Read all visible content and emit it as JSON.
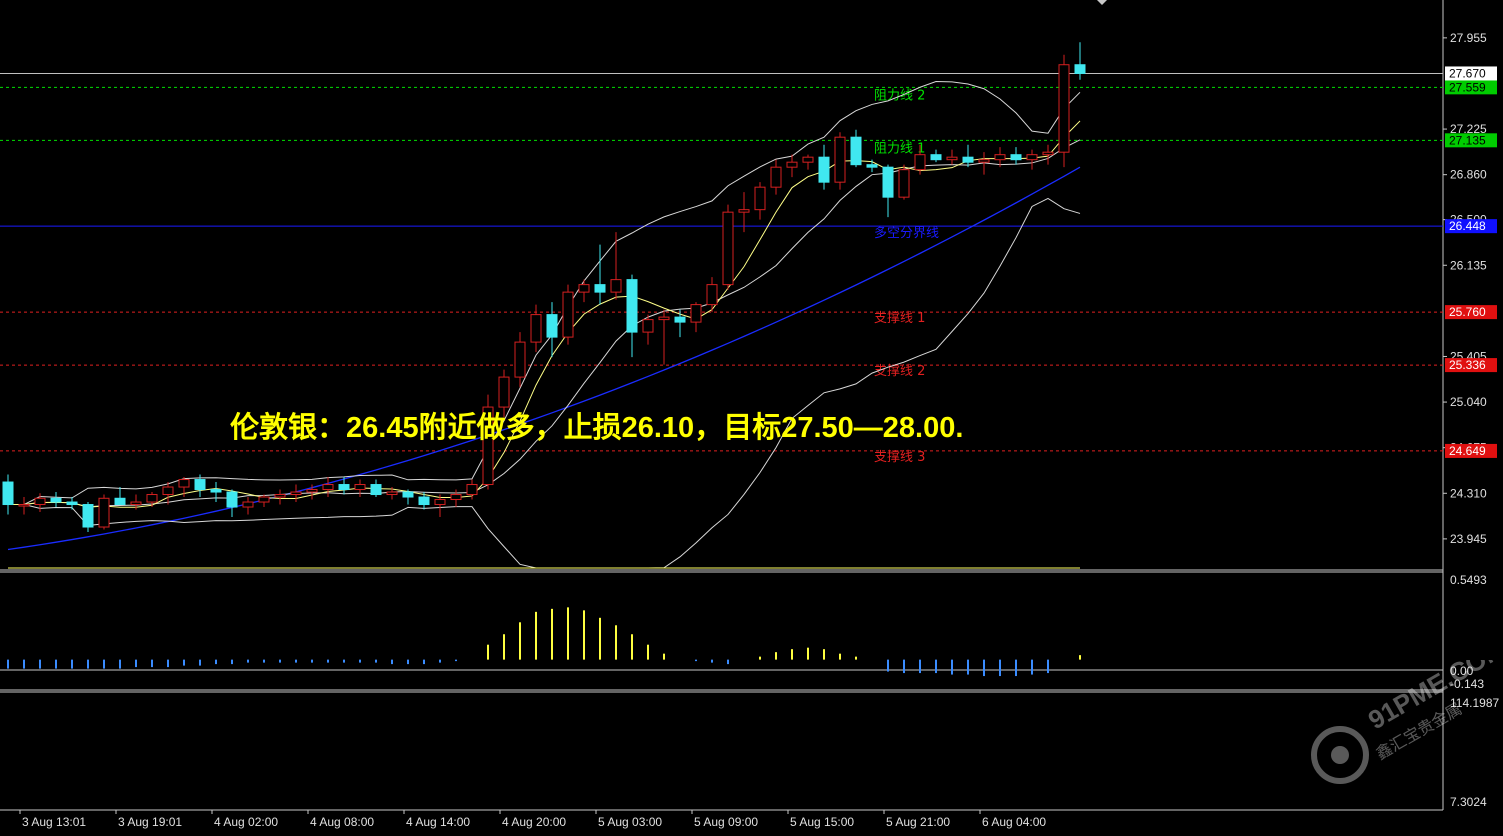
{
  "annotation": {
    "prefix": "伦敦银：",
    "entry": "26.45",
    "mid1": "附近做多，止损",
    "stop": "26.10",
    "mid2": "，目标",
    "target": "27.50—28.00."
  },
  "watermark": {
    "text": "91PME.COM",
    "sub": "鑫汇宝贵金属"
  },
  "colors": {
    "background": "#000000",
    "bull": "#d42020",
    "bear": "#40e8f0",
    "resistance": "#00e000",
    "support": "#e02020",
    "pivot": "#1a1aff",
    "ma_long": "#1a2cff",
    "bollinger": "#d8d8d8",
    "ma_fast": "#ffff88",
    "axis_text": "#e0e0e0",
    "macd_signal": "#e02020",
    "macd_line": "#40e0e0",
    "hist_pos": "#ffff40",
    "hist_neg": "#3a8cff"
  },
  "chart_data": [
    {
      "type": "candlestick",
      "ylim": [
        23.76,
        28.21
      ],
      "ticks": [
        "27.955",
        "27.225",
        "26.860",
        "26.500",
        "26.135",
        "25.405",
        "25.040",
        "24.675",
        "24.310",
        "23.945"
      ],
      "xlabels": [
        "3 Aug 13:01",
        "3 Aug 19:01",
        "4 Aug 02:00",
        "4 Aug 08:00",
        "4 Aug 14:00",
        "4 Aug 20:00",
        "5 Aug 03:00",
        "5 Aug 09:00",
        "5 Aug 15:00",
        "5 Aug 21:00",
        "6 Aug 04:00"
      ],
      "current_price": {
        "value": 27.67,
        "label": "27.670"
      },
      "levels": [
        {
          "name": "阻力线 2",
          "value": 27.559,
          "label": "27.559",
          "kind": "resistance"
        },
        {
          "name": "阻力线 1",
          "value": 27.135,
          "label": "27.135",
          "kind": "resistance"
        },
        {
          "name": "多空分界线",
          "value": 26.448,
          "label": "26.448",
          "kind": "pivot"
        },
        {
          "name": "支撑线 1",
          "value": 25.76,
          "label": "25.760",
          "kind": "support"
        },
        {
          "name": "支撑线 2",
          "value": 25.336,
          "label": "25.336",
          "kind": "support"
        },
        {
          "name": "支撑线 3",
          "value": 24.649,
          "label": "24.649",
          "kind": "support"
        }
      ],
      "candles": [
        [
          24.4,
          24.46,
          24.14,
          24.22
        ],
        [
          24.22,
          24.28,
          24.14,
          24.22
        ],
        [
          24.22,
          24.31,
          24.16,
          24.27
        ],
        [
          24.27,
          24.32,
          24.2,
          24.24
        ],
        [
          24.24,
          24.28,
          24.18,
          24.22
        ],
        [
          24.22,
          24.24,
          24.0,
          24.04
        ],
        [
          24.04,
          24.3,
          24.02,
          24.27
        ],
        [
          24.27,
          24.36,
          24.22,
          24.22
        ],
        [
          24.22,
          24.3,
          24.18,
          24.24
        ],
        [
          24.24,
          24.32,
          24.2,
          24.3
        ],
        [
          24.3,
          24.4,
          24.22,
          24.36
        ],
        [
          24.36,
          24.44,
          24.28,
          24.42
        ],
        [
          24.42,
          24.46,
          24.28,
          24.34
        ],
        [
          24.34,
          24.4,
          24.24,
          24.32
        ],
        [
          24.32,
          24.34,
          24.12,
          24.2
        ],
        [
          24.2,
          24.28,
          24.14,
          24.24
        ],
        [
          24.24,
          24.3,
          24.2,
          24.28
        ],
        [
          24.28,
          24.34,
          24.22,
          24.3
        ],
        [
          24.3,
          24.38,
          24.24,
          24.32
        ],
        [
          24.32,
          24.38,
          24.26,
          24.34
        ],
        [
          24.34,
          24.44,
          24.28,
          24.38
        ],
        [
          24.38,
          24.44,
          24.3,
          24.34
        ],
        [
          24.34,
          24.42,
          24.28,
          24.38
        ],
        [
          24.38,
          24.42,
          24.28,
          24.3
        ],
        [
          24.3,
          24.36,
          24.26,
          24.32
        ],
        [
          24.32,
          24.34,
          24.22,
          24.28
        ],
        [
          24.28,
          24.32,
          24.18,
          24.22
        ],
        [
          24.22,
          24.3,
          24.12,
          24.26
        ],
        [
          24.26,
          24.34,
          24.2,
          24.3
        ],
        [
          24.3,
          24.42,
          24.26,
          24.38
        ],
        [
          24.38,
          25.1,
          24.34,
          25.0
        ],
        [
          25.0,
          25.3,
          24.92,
          25.24
        ],
        [
          25.24,
          25.6,
          25.16,
          25.52
        ],
        [
          25.52,
          25.82,
          25.44,
          25.74
        ],
        [
          25.74,
          25.84,
          25.4,
          25.56
        ],
        [
          25.56,
          25.98,
          25.5,
          25.92
        ],
        [
          25.92,
          26.02,
          25.84,
          25.98
        ],
        [
          25.98,
          26.3,
          25.82,
          25.92
        ],
        [
          25.92,
          26.4,
          25.86,
          26.02
        ],
        [
          26.02,
          26.06,
          25.4,
          25.6
        ],
        [
          25.6,
          25.74,
          25.5,
          25.7
        ],
        [
          25.7,
          25.78,
          25.34,
          25.72
        ],
        [
          25.72,
          25.78,
          25.56,
          25.68
        ],
        [
          25.68,
          25.84,
          25.6,
          25.82
        ],
        [
          25.82,
          26.04,
          25.76,
          25.98
        ],
        [
          25.98,
          26.62,
          25.94,
          26.56
        ],
        [
          26.56,
          26.72,
          26.4,
          26.58
        ],
        [
          26.58,
          26.8,
          26.5,
          26.76
        ],
        [
          26.76,
          26.98,
          26.7,
          26.92
        ],
        [
          26.92,
          27.02,
          26.84,
          26.96
        ],
        [
          26.96,
          27.02,
          26.9,
          27.0
        ],
        [
          27.0,
          27.1,
          26.74,
          26.8
        ],
        [
          26.8,
          27.2,
          26.74,
          27.16
        ],
        [
          27.16,
          27.22,
          26.92,
          26.94
        ],
        [
          26.94,
          26.98,
          26.88,
          26.92
        ],
        [
          26.92,
          26.94,
          26.52,
          26.68
        ],
        [
          26.68,
          26.94,
          26.66,
          26.9
        ],
        [
          26.9,
          27.1,
          26.86,
          27.02
        ],
        [
          27.02,
          27.06,
          26.96,
          26.98
        ],
        [
          26.98,
          27.06,
          26.94,
          27.0
        ],
        [
          27.0,
          27.1,
          26.92,
          26.96
        ],
        [
          26.96,
          27.04,
          26.86,
          26.98
        ],
        [
          26.98,
          27.08,
          26.92,
          27.02
        ],
        [
          27.02,
          27.08,
          26.94,
          26.98
        ],
        [
          26.98,
          27.06,
          26.9,
          27.02
        ],
        [
          27.02,
          27.1,
          26.94,
          27.04
        ],
        [
          27.04,
          27.82,
          26.92,
          27.74
        ],
        [
          27.74,
          27.92,
          27.62,
          27.67
        ]
      ]
    },
    {
      "type": "macd",
      "ylim": [
        -0.19,
        0.56
      ],
      "ticks": [
        "0.5493",
        "0.00",
        "-0.143"
      ],
      "histogram": [
        -0.06,
        -0.06,
        -0.06,
        -0.06,
        -0.06,
        -0.06,
        -0.06,
        -0.06,
        -0.05,
        -0.05,
        -0.05,
        -0.04,
        -0.04,
        -0.03,
        -0.03,
        -0.02,
        -0.02,
        -0.02,
        -0.02,
        -0.02,
        -0.02,
        -0.02,
        -0.02,
        -0.02,
        -0.03,
        -0.03,
        -0.03,
        -0.02,
        -0.01,
        0.0,
        0.1,
        0.17,
        0.25,
        0.32,
        0.34,
        0.35,
        0.33,
        0.28,
        0.23,
        0.17,
        0.1,
        0.04,
        0.0,
        -0.01,
        -0.02,
        -0.03,
        0.0,
        0.02,
        0.05,
        0.07,
        0.08,
        0.07,
        0.04,
        0.02,
        0.0,
        -0.08,
        -0.09,
        -0.09,
        -0.09,
        -0.1,
        -0.1,
        -0.11,
        -0.11,
        -0.11,
        -0.1,
        -0.09,
        0.0,
        0.03
      ],
      "signal": [
        0.17,
        0.165,
        0.16,
        0.155,
        0.15,
        0.145,
        0.14,
        0.135,
        0.13,
        0.125,
        0.12,
        0.115,
        0.11,
        0.105,
        0.1,
        0.095,
        0.09,
        0.085,
        0.08,
        0.075,
        0.072,
        0.07,
        0.068,
        0.066,
        0.064,
        0.062,
        0.06,
        0.058,
        0.057,
        0.058,
        0.08,
        0.12,
        0.17,
        0.22,
        0.27,
        0.32,
        0.36,
        0.39,
        0.41,
        0.435,
        0.45,
        0.46,
        0.47,
        0.47,
        0.475,
        0.48,
        0.48,
        0.48,
        0.482,
        0.486,
        0.49,
        0.495,
        0.5,
        0.5,
        0.5,
        0.495,
        0.485,
        0.475,
        0.465,
        0.45,
        0.43,
        0.41,
        0.39,
        0.37,
        0.35,
        0.34,
        0.34,
        0.335
      ],
      "macd": [
        0.12,
        0.116,
        0.112,
        0.108,
        0.104,
        0.1,
        0.096,
        0.092,
        0.088,
        0.085,
        0.082,
        0.08,
        0.078,
        0.076,
        0.074,
        0.073,
        0.072,
        0.071,
        0.07,
        0.07,
        0.07,
        0.07,
        0.069,
        0.068,
        0.066,
        0.064,
        0.062,
        0.06,
        0.06,
        0.064,
        0.12,
        0.19,
        0.27,
        0.34,
        0.38,
        0.42,
        0.44,
        0.46,
        0.48,
        0.49,
        0.485,
        0.47,
        0.46,
        0.46,
        0.47,
        0.47,
        0.47,
        0.475,
        0.49,
        0.51,
        0.51,
        0.51,
        0.5,
        0.49,
        0.48,
        0.44,
        0.44,
        0.43,
        0.42,
        0.41,
        0.39,
        0.37,
        0.35,
        0.33,
        0.31,
        0.3,
        0.32,
        0.36
      ]
    },
    {
      "type": "oscillator",
      "ylim": [
        0,
        100
      ],
      "ticks": [
        "114.1987",
        "7.3024"
      ],
      "purple": [
        50,
        45,
        42,
        45,
        55,
        40,
        32,
        50,
        62,
        70,
        80,
        92,
        85,
        70,
        55,
        48,
        45,
        55,
        70,
        80,
        68,
        52,
        45,
        40,
        20,
        15,
        25,
        40,
        55,
        75,
        92,
        95,
        90,
        82,
        80,
        92,
        90,
        85,
        88,
        75,
        55,
        35,
        32,
        42,
        55,
        80,
        90,
        92,
        88,
        85,
        75,
        75,
        72,
        55,
        35,
        40,
        55,
        62,
        58,
        60,
        60,
        62,
        65,
        70,
        65,
        58,
        75,
        78
      ],
      "yellow": [
        52,
        50,
        48,
        48,
        50,
        46,
        42,
        45,
        50,
        55,
        62,
        68,
        70,
        66,
        62,
        58,
        54,
        53,
        56,
        62,
        62,
        58,
        54,
        50,
        40,
        32,
        30,
        34,
        42,
        55,
        68,
        78,
        82,
        82,
        82,
        85,
        86,
        85,
        86,
        80,
        70,
        58,
        50,
        48,
        50,
        60,
        70,
        78,
        80,
        82,
        80,
        78,
        76,
        68,
        56,
        52,
        54,
        58,
        58,
        60,
        60,
        61,
        62,
        64,
        63,
        61,
        66,
        70
      ],
      "cyan": [
        55,
        54,
        52,
        50,
        50,
        48,
        46,
        46,
        48,
        52,
        56,
        60,
        62,
        62,
        61,
        60,
        58,
        56,
        56,
        58,
        59,
        58,
        56,
        54,
        48,
        42,
        38,
        38,
        40,
        46,
        54,
        62,
        68,
        72,
        74,
        77,
        79,
        80,
        81,
        79,
        74,
        67,
        61,
        57,
        56,
        58,
        62,
        67,
        70,
        73,
        74,
        74,
        73,
        70,
        64,
        60,
        58,
        58,
        58,
        59,
        59,
        60,
        60,
        61,
        61,
        61,
        63,
        65
      ]
    }
  ]
}
